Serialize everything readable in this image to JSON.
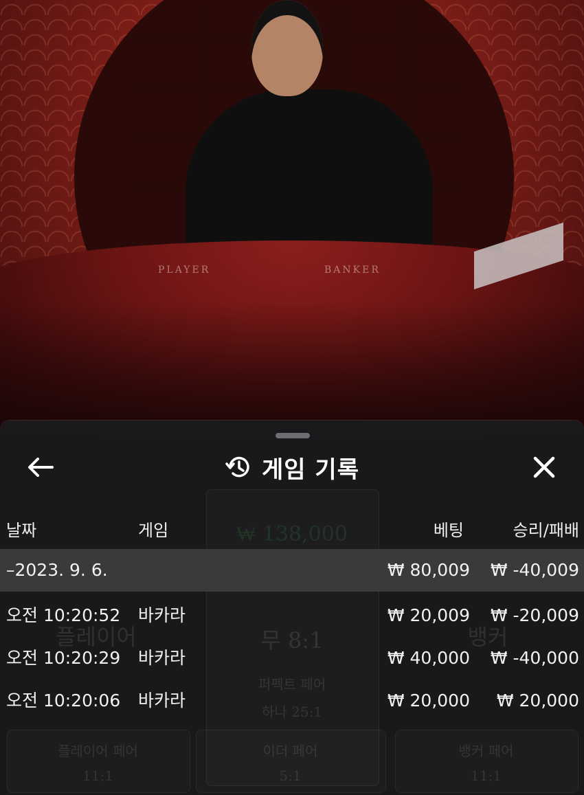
{
  "video": {
    "table_labels": [
      "PLAYER",
      "BANKER"
    ]
  },
  "background_ui": {
    "balance": "₩ 138,000",
    "tie": "무 8:1",
    "player": "플레이어",
    "banker": "뱅커",
    "perfect_pair": "퍼펙트 페어",
    "perfect_pair_odds": "하나 25:1",
    "player_pair": "플레이어 페어",
    "player_pair_odds": "11:1",
    "either_pair": "이더 페어",
    "either_pair_odds": "5:1",
    "banker_pair": "뱅커 페어",
    "banker_pair_odds": "11:1"
  },
  "sheet": {
    "title": "게임 기록",
    "title_icon": "history-icon",
    "back_icon": "arrow-left-icon",
    "close_icon": "close-icon",
    "columns": {
      "date": "날짜",
      "game": "게임",
      "bet": "베팅",
      "win_loss": "승리/패배"
    },
    "summary": {
      "date": "–2023. 9. 6.",
      "bet": "₩ 80,009",
      "win_loss": "₩ -40,009"
    },
    "rows": [
      {
        "time": "오전 10:20:52",
        "game": "바카라",
        "bet": "₩ 20,009",
        "win_loss": "₩ -20,009"
      },
      {
        "time": "오전 10:20:29",
        "game": "바카라",
        "bet": "₩ 40,000",
        "win_loss": "₩ -40,000"
      },
      {
        "time": "오전 10:20:06",
        "game": "바카라",
        "bet": "₩ 20,000",
        "win_loss": "₩ 20,000"
      }
    ]
  },
  "colors": {
    "sheet_bg": "#1a1a1c",
    "summary_bg": "#3a3a3d",
    "text": "#f2f2f2"
  }
}
